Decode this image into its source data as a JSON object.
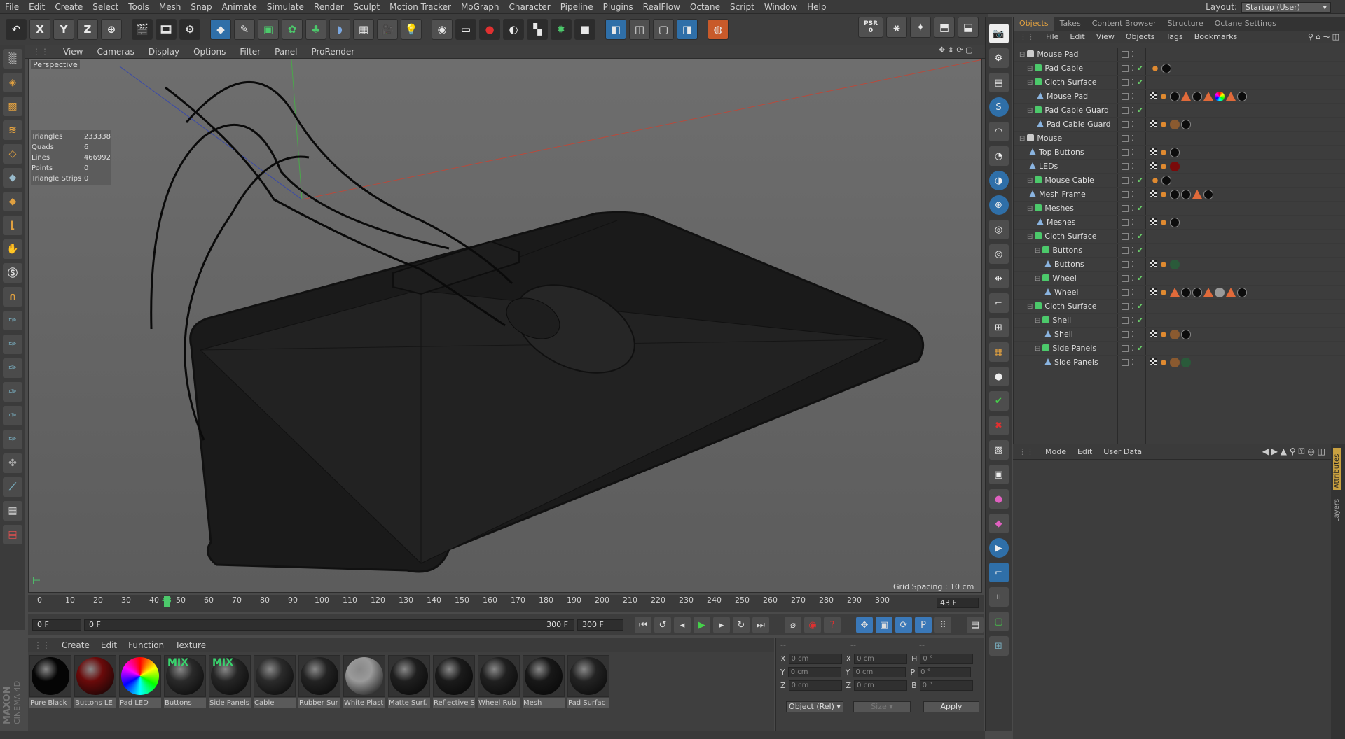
{
  "menubar": {
    "items": [
      "File",
      "Edit",
      "Create",
      "Select",
      "Tools",
      "Mesh",
      "Snap",
      "Animate",
      "Simulate",
      "Render",
      "Sculpt",
      "Motion Tracker",
      "MoGraph",
      "Character",
      "Pipeline",
      "Plugins",
      "RealFlow",
      "Octane",
      "Script",
      "Window",
      "Help"
    ],
    "layout_label": "Layout:",
    "layout_value": "Startup (User)"
  },
  "toolbar": {
    "axis_x": "X",
    "axis_y": "Y",
    "axis_z": "Z",
    "psr_label": "PSR",
    "psr_value": "0"
  },
  "viewport": {
    "menu": [
      "View",
      "Cameras",
      "Display",
      "Options",
      "Filter",
      "Panel",
      "ProRender"
    ],
    "title": "Perspective",
    "stats": [
      {
        "label": "Triangles",
        "value": "233338"
      },
      {
        "label": "Quads",
        "value": "6"
      },
      {
        "label": "Lines",
        "value": "466992"
      },
      {
        "label": "Points",
        "value": "0"
      },
      {
        "label": "Triangle Strips",
        "value": "0"
      }
    ],
    "grid_spacing": "Grid Spacing : 10 cm"
  },
  "timeline": {
    "ticks": [
      "0",
      "10",
      "20",
      "30",
      "40",
      "43",
      "50",
      "60",
      "70",
      "80",
      "90",
      "100",
      "110",
      "120",
      "130",
      "140",
      "150",
      "160",
      "170",
      "180",
      "190",
      "200",
      "210",
      "220",
      "230",
      "240",
      "250",
      "260",
      "270",
      "280",
      "290",
      "300"
    ],
    "current_frame": "43 F",
    "start_field": "0 F",
    "range_start": "0 F",
    "range_end": "300 F",
    "end_field": "300 F"
  },
  "materials": {
    "menu": [
      "Create",
      "Edit",
      "Function",
      "Texture"
    ],
    "items": [
      {
        "name": "Pure Black",
        "color": "#050505",
        "mix": ""
      },
      {
        "name": "Buttons LE",
        "color": "#6a0a0a",
        "mix": ""
      },
      {
        "name": "Pad LED",
        "color": "rainbow",
        "mix": ""
      },
      {
        "name": "Buttons",
        "color": "#2a2a2a",
        "mix": "MIX"
      },
      {
        "name": "Side Panels",
        "color": "#262626",
        "mix": "MIX"
      },
      {
        "name": "Cable",
        "color": "#2b2b2b",
        "mix": ""
      },
      {
        "name": "Rubber Sur",
        "color": "#232323",
        "mix": ""
      },
      {
        "name": "White Plast",
        "color": "#9a9a9a",
        "mix": ""
      },
      {
        "name": "Matte Surf.",
        "color": "#1f1f1f",
        "mix": ""
      },
      {
        "name": "Reflective S",
        "color": "#1b1b1b",
        "mix": ""
      },
      {
        "name": "Wheel Rub",
        "color": "#202020",
        "mix": ""
      },
      {
        "name": "Mesh",
        "color": "#181818",
        "mix": ""
      },
      {
        "name": "Pad Surfac",
        "color": "#232323",
        "mix": ""
      }
    ]
  },
  "coords": {
    "headers": [
      "--",
      "--",
      "--"
    ],
    "rows": [
      {
        "a": "X",
        "av": "0 cm",
        "b": "X",
        "bv": "0 cm",
        "c": "H",
        "cv": "0 °"
      },
      {
        "a": "Y",
        "av": "0 cm",
        "b": "Y",
        "bv": "0 cm",
        "c": "P",
        "cv": "0 °"
      },
      {
        "a": "Z",
        "av": "0 cm",
        "b": "Z",
        "bv": "0 cm",
        "c": "B",
        "cv": "0 °"
      }
    ],
    "mode": "Object (Rel)",
    "size": "Size",
    "apply": "Apply"
  },
  "objects_panel": {
    "tabs": [
      "Objects",
      "Takes",
      "Content Browser",
      "Structure",
      "Octane Settings"
    ],
    "menu": [
      "File",
      "Edit",
      "View",
      "Objects",
      "Tags",
      "Bookmarks"
    ],
    "rows": [
      {
        "name": "Mouse Pad",
        "level": 0,
        "type": "null",
        "check": false,
        "tags": []
      },
      {
        "name": "Pad Cable",
        "level": 1,
        "type": "spline",
        "check": true,
        "tags": [
          "orange",
          "black"
        ]
      },
      {
        "name": "Cloth Surface",
        "level": 1,
        "type": "gen",
        "check": true,
        "tags": []
      },
      {
        "name": "Mouse Pad",
        "level": 2,
        "type": "poly",
        "check": false,
        "tags": [
          "checker",
          "orange",
          "black",
          "tri",
          "black",
          "tri",
          "rainbow",
          "tri",
          "black"
        ]
      },
      {
        "name": "Pad Cable Guard",
        "level": 1,
        "type": "gen",
        "check": true,
        "tags": []
      },
      {
        "name": "Pad Cable Guard",
        "level": 2,
        "type": "poly",
        "check": false,
        "tags": [
          "checker",
          "orange",
          "brown",
          "black"
        ]
      },
      {
        "name": "Mouse",
        "level": 0,
        "type": "null",
        "check": false,
        "tags": []
      },
      {
        "name": "Top Buttons",
        "level": 1,
        "type": "poly",
        "check": false,
        "tags": [
          "checker",
          "orange",
          "black"
        ]
      },
      {
        "name": "LEDs",
        "level": 1,
        "type": "poly",
        "check": false,
        "tags": [
          "checker",
          "orange",
          "red"
        ]
      },
      {
        "name": "Mouse Cable",
        "level": 1,
        "type": "spline",
        "check": true,
        "tags": [
          "orange",
          "black"
        ]
      },
      {
        "name": "Mesh Frame",
        "level": 1,
        "type": "poly",
        "check": false,
        "tags": [
          "checker",
          "orange",
          "black",
          "black",
          "tri",
          "black"
        ]
      },
      {
        "name": "Meshes",
        "level": 1,
        "type": "gen",
        "check": true,
        "tags": []
      },
      {
        "name": "Meshes",
        "level": 2,
        "type": "poly",
        "check": false,
        "tags": [
          "checker",
          "orange",
          "black"
        ]
      },
      {
        "name": "Cloth Surface",
        "level": 1,
        "type": "gen",
        "check": true,
        "tags": []
      },
      {
        "name": "Buttons",
        "level": 2,
        "type": "gen",
        "check": true,
        "tags": []
      },
      {
        "name": "Buttons",
        "level": 3,
        "type": "poly",
        "check": false,
        "tags": [
          "checker",
          "orange",
          "green"
        ]
      },
      {
        "name": "Wheel",
        "level": 2,
        "type": "gen",
        "check": true,
        "tags": []
      },
      {
        "name": "Wheel",
        "level": 3,
        "type": "poly",
        "check": false,
        "tags": [
          "checker",
          "orange",
          "tri",
          "black",
          "black",
          "tri",
          "grey",
          "tri",
          "black"
        ]
      },
      {
        "name": "Cloth Surface",
        "level": 1,
        "type": "gen",
        "check": true,
        "tags": []
      },
      {
        "name": "Shell",
        "level": 2,
        "type": "gen",
        "check": true,
        "tags": []
      },
      {
        "name": "Shell",
        "level": 3,
        "type": "poly",
        "check": false,
        "tags": [
          "checker",
          "orange",
          "brown",
          "black"
        ]
      },
      {
        "name": "Side Panels",
        "level": 2,
        "type": "gen",
        "check": true,
        "tags": []
      },
      {
        "name": "Side Panels",
        "level": 3,
        "type": "poly",
        "check": false,
        "tags": [
          "checker",
          "orange",
          "brown",
          "green"
        ]
      }
    ]
  },
  "attributes_panel": {
    "menu": [
      "Mode",
      "Edit",
      "User Data"
    ],
    "side_tabs": [
      "Attributes",
      "Layers"
    ]
  },
  "brand": {
    "line1": "MAXON",
    "line2": "CINEMA 4D"
  },
  "colors": {
    "accent_blue": "#2f6fa8",
    "accent_orange": "#e0a040",
    "play_green": "#45d14a",
    "record_red": "#e03030"
  }
}
